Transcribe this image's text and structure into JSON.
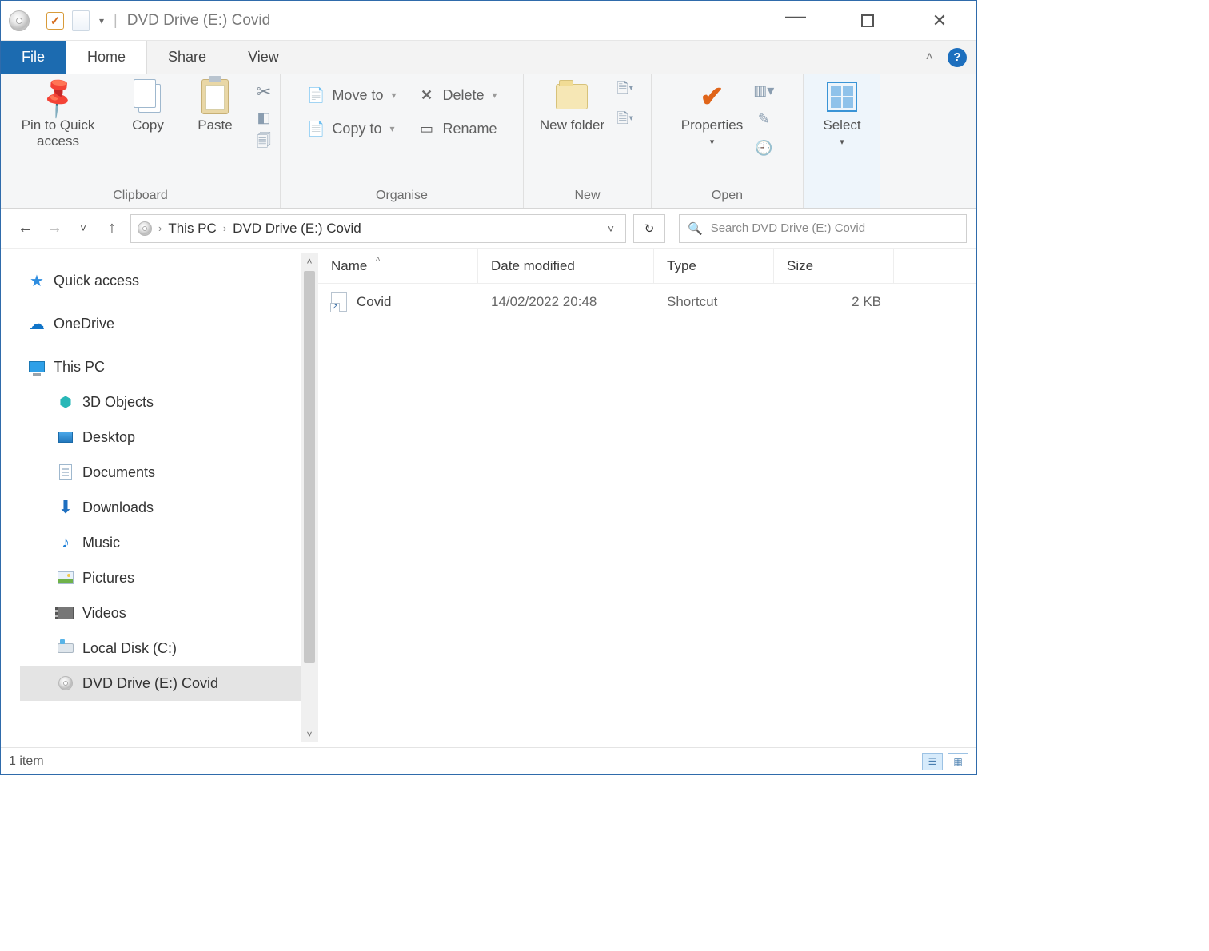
{
  "title": "DVD Drive (E:) Covid",
  "tabs": {
    "file": "File",
    "home": "Home",
    "share": "Share",
    "view": "View"
  },
  "ribbon": {
    "clipboard": {
      "label": "Clipboard",
      "pin": "Pin to Quick access",
      "copy": "Copy",
      "paste": "Paste"
    },
    "organise": {
      "label": "Organise",
      "move_to": "Move to",
      "copy_to": "Copy to",
      "delete": "Delete",
      "rename": "Rename"
    },
    "new": {
      "label": "New",
      "new_folder": "New folder"
    },
    "open": {
      "label": "Open",
      "properties": "Properties"
    },
    "select": {
      "label": "Select"
    }
  },
  "breadcrumb": {
    "root": "This PC",
    "current": "DVD Drive (E:) Covid"
  },
  "search_placeholder": "Search DVD Drive (E:) Covid",
  "sidebar": {
    "quick_access": "Quick access",
    "onedrive": "OneDrive",
    "this_pc": "This PC",
    "children": {
      "objects3d": "3D Objects",
      "desktop": "Desktop",
      "documents": "Documents",
      "downloads": "Downloads",
      "music": "Music",
      "pictures": "Pictures",
      "videos": "Videos",
      "local_disk": "Local Disk (C:)",
      "dvd": "DVD Drive (E:) Covid"
    }
  },
  "columns": {
    "name": "Name",
    "date": "Date modified",
    "type": "Type",
    "size": "Size"
  },
  "rows": [
    {
      "name": "Covid",
      "date": "14/02/2022 20:48",
      "type": "Shortcut",
      "size": "2 KB"
    }
  ],
  "status": "1 item"
}
